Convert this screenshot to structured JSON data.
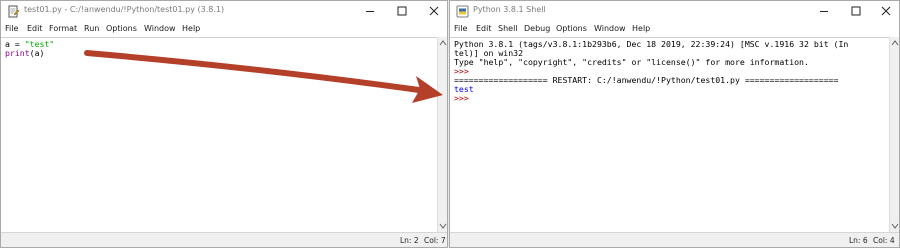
{
  "editor": {
    "title": "test01.py - C:/!anwendu/!Python/test01.py (3.8.1)",
    "menu": [
      "File",
      "Edit",
      "Format",
      "Run",
      "Options",
      "Window",
      "Help"
    ],
    "code": {
      "line1": {
        "name": "a",
        "op": " = ",
        "string": "\"test\""
      },
      "line2": {
        "builtin": "print",
        "rest": "(a)"
      }
    },
    "status": {
      "ln": "Ln: 2",
      "col": "Col: 7"
    }
  },
  "shell": {
    "title": "Python 3.8.1 Shell",
    "menu": [
      "File",
      "Edit",
      "Shell",
      "Debug",
      "Options",
      "Window",
      "Help"
    ],
    "lines": {
      "l1": "Python 3.8.1 (tags/v3.8.1:1b293b6, Dec 18 2019, 22:39:24) [MSC v.1916 32 bit (In",
      "l2": "tel)] on win32",
      "l3": "Type \"help\", \"copyright\", \"credits\" or \"license()\" for more information.",
      "l4": ">>>",
      "l5": "=================== RESTART: C:/!anwendu/!Python/test01.py ===================",
      "l6": "test",
      "l7": ">>>"
    },
    "status": {
      "ln": "Ln: 6",
      "col": "Col: 4"
    }
  },
  "annotation": {
    "arrow_color": "#b5402a"
  },
  "colors": {
    "string": "#00aa00",
    "builtin": "#900090",
    "prompt": "#c00000",
    "output": "#0000ff"
  }
}
